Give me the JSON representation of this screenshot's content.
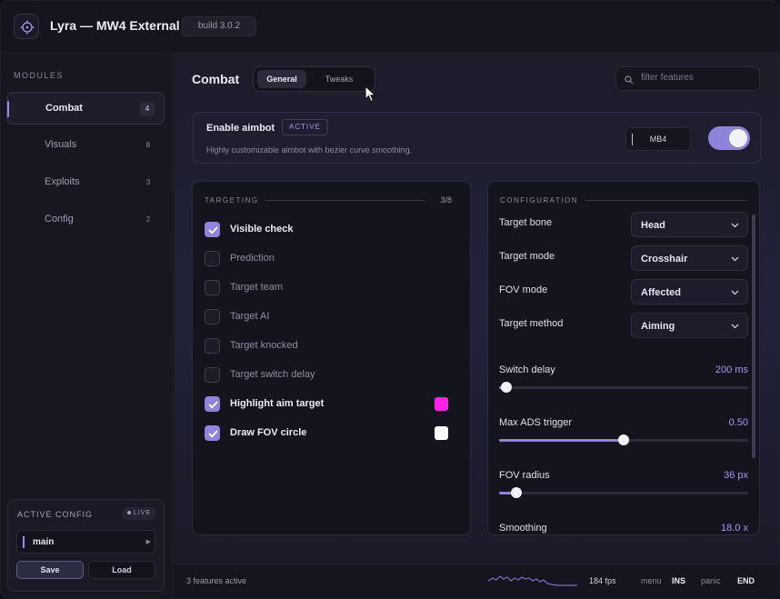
{
  "app": {
    "title": "Lyra — MW4 External",
    "build": "build 3.0.2"
  },
  "sidebar": {
    "header": "MODULES",
    "items": [
      {
        "label": "Combat",
        "count": "4"
      },
      {
        "label": "Visuals",
        "count": "8"
      },
      {
        "label": "Exploits",
        "count": "3"
      },
      {
        "label": "Config",
        "count": "2"
      }
    ],
    "active_config": {
      "title": "ACTIVE CONFIG",
      "live": "LIVE",
      "value": "main",
      "save": "Save",
      "load": "Load"
    }
  },
  "main": {
    "title": "Combat",
    "tabs": [
      "General",
      "Tweaks"
    ],
    "search_placeholder": "filter features",
    "aimbot": {
      "title": "Enable aimbot",
      "badge": "ACTIVE",
      "description": "Highly customizable aimbot with bezier curve smoothing.",
      "keybind": "MB4",
      "enabled": true
    },
    "targeting": {
      "title": "TARGETING",
      "count": "3/8",
      "items": [
        {
          "label": "Visible check",
          "checked": true
        },
        {
          "label": "Prediction",
          "checked": false
        },
        {
          "label": "Target team",
          "checked": false
        },
        {
          "label": "Target AI",
          "checked": false
        },
        {
          "label": "Target knocked",
          "checked": false
        },
        {
          "label": "Target switch delay",
          "checked": false
        },
        {
          "label": "Highlight aim target",
          "checked": true,
          "color": "#ff22e8"
        },
        {
          "label": "Draw FOV circle",
          "checked": true,
          "color": "#ffffff"
        }
      ]
    },
    "configuration": {
      "title": "CONFIGURATION",
      "selects": [
        {
          "label": "Target bone",
          "value": "Head"
        },
        {
          "label": "Target mode",
          "value": "Crosshair"
        },
        {
          "label": "FOV mode",
          "value": "Affected"
        },
        {
          "label": "Target method",
          "value": "Aiming"
        }
      ],
      "sliders": [
        {
          "label": "Switch delay",
          "value": "200 ms",
          "fraction": 0.03
        },
        {
          "label": "Max ADS trigger",
          "value": "0.50",
          "fraction": 0.5
        },
        {
          "label": "FOV radius",
          "value": "36 px",
          "fraction": 0.07
        },
        {
          "label": "Smoothing",
          "value": "18.0 x",
          "fraction": 0.35
        }
      ]
    }
  },
  "status": {
    "features": "3 features active",
    "fps": "184 fps",
    "menu_label": "menu",
    "menu_key": "INS",
    "panic_label": "panic",
    "panic_key": "END"
  },
  "colors": {
    "accent": "#8e84dc",
    "accent_text": "#a498f2"
  },
  "icons": {
    "logo": "crosshair-icon",
    "search": "search-icon",
    "chevron": "chevron-down-icon",
    "cursor": "mouse-cursor-icon"
  }
}
